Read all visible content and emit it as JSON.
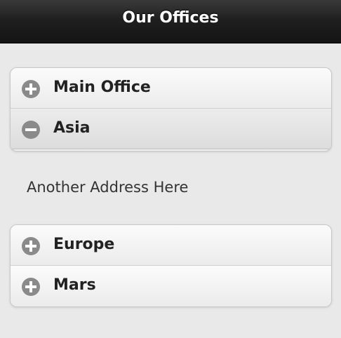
{
  "header": {
    "title": "Our Offices"
  },
  "collapsible": {
    "items": [
      {
        "label": "Main Office",
        "state": "collapsed",
        "icon": "plus-icon"
      },
      {
        "label": "Asia",
        "state": "expanded",
        "icon": "minus-icon",
        "content": "Another Address Here"
      },
      {
        "label": "Europe",
        "state": "collapsed",
        "icon": "plus-icon"
      },
      {
        "label": "Mars",
        "state": "collapsed",
        "icon": "plus-icon"
      }
    ]
  },
  "colors": {
    "header_bg": "#1f1f1f",
    "page_bg": "#e9e9e9",
    "icon_bg": "#8a8a8a"
  }
}
